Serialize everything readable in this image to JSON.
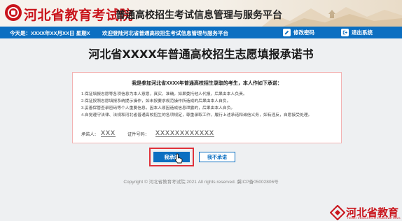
{
  "header": {
    "brand": "河北省教育考试院",
    "site_title": "普通高校招生考试信息管理与服务平台"
  },
  "navbar": {
    "today": "今天是：XXXX年XX月XX日 星期X",
    "welcome": "欢迎登陆河北省普通高校招生考试信息管理与服务平台",
    "edit_password": "修改密码",
    "exit_system": "退出系统"
  },
  "page": {
    "title": "河北省XXXX年普通高校招生志愿填报承诺书"
  },
  "pledge": {
    "heading": "我是参加河北省XXXX年普通高校招生录取的考生，本人作如下承诺：",
    "items": [
      "1.保证填报志愿等各项信息为本人意愿，真实、准确，如果委托他人代报，后果由本人负责。",
      "2.保证按照志愿填报系统提示操作，如未按要求规范操作所造成的后果由本人自负。",
      "3.妥善保管查录密码等个人重要信息，因本人原因造成信息泄露的，后果由本人自负。",
      "4.自觉遵守法律、法规和河北省普通高校招生的各项规定，尊重录取工作，履行上述承诺和诚信义务，如有违反，自愿接受处理。"
    ],
    "signer_label": "承诺人：",
    "signer_value": "XXX",
    "id_label": "证件号码：",
    "id_value": "XXXXXXXXXXXX"
  },
  "buttons": {
    "agree": "我承诺",
    "disagree": "我不承诺"
  },
  "footer": {
    "copyright": "Copyright © 河北省教育考试院 2021 All rights reserved.   冀ICP备05002806号"
  },
  "watermark": {
    "text": "河北省教育",
    "sub": "HEBEI EDUCATION EXAMINATIONS"
  },
  "colors": {
    "brand_red": "#c9141b",
    "nav_blue": "#0c6fc1",
    "highlight_red": "#e0313a"
  }
}
